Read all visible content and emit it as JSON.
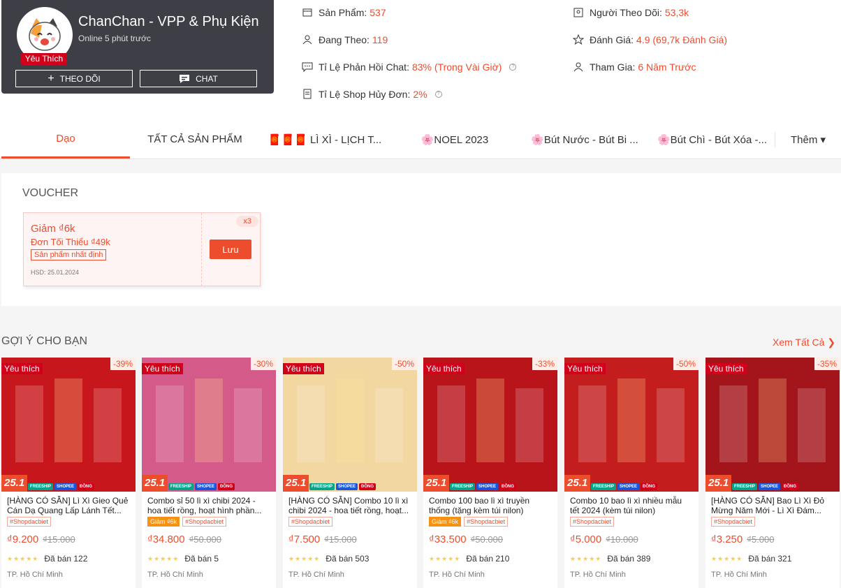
{
  "shop": {
    "name": "ChanChan - VPP & Phụ Kiện",
    "online": "Online 5 phút trước",
    "fav_badge": "Yêu Thích",
    "follow_label": "THEO DÕI",
    "chat_label": "CHAT"
  },
  "stats": {
    "products_label": "Sản Phẩm:",
    "products_value": "537",
    "following_label": "Đang Theo:",
    "following_value": "119",
    "chat_label": "Tỉ Lệ Phản Hồi Chat:",
    "chat_value": "83% (Trong Vài Giờ)",
    "cancel_label": "Tỉ Lệ Shop Hủy Đơn:",
    "cancel_value": "2%",
    "followers_label": "Người Theo Dõi:",
    "followers_value": "53,3k",
    "rating_label": "Đánh Giá:",
    "rating_value": "4.9 (69,7k Đánh Giá)",
    "joined_label": "Tham Gia:",
    "joined_value": "6 Năm Trước"
  },
  "tabs": [
    "Dạo",
    "TẤT CẢ SẢN PHẨM",
    "🧧🧧🧧 LÌ XÌ - LỊCH T...",
    "🌸NOEL 2023",
    "🌸Bút Nước - Bút Bi ...",
    "🌸Bút Chì - Bút Xóa -...",
    "Thêm ▾"
  ],
  "voucher": {
    "section_title": "VOUCHER",
    "discount": "Giảm ₫6k",
    "min_order": "Đơn Tối Thiểu ₫49k",
    "condition": "Sản phẩm nhất định",
    "expiry": "HSD: 25.01.2024",
    "count": "x3",
    "save_label": "Lưu"
  },
  "suggest": {
    "title": "GỢI Ý CHO BẠN",
    "see_all": "Xem Tất Cả ❯"
  },
  "products": [
    {
      "title": "[HÀNG CÓ SẴN] Lì Xì Gieo Quẻ Cán Dạ Quang Lấp Lánh Tết...",
      "fav": "Yêu thích",
      "discount": "-39%",
      "date": "25.1",
      "tags": [
        "#Shopdacbiet"
      ],
      "price": "₫9.200",
      "old_price": "₫15.000",
      "sold": "Đã bán 122",
      "location": "TP. Hồ Chí Minh",
      "color": "#c8171c"
    },
    {
      "title": "Combo sỉ 50 lì xì chibi 2024 - hoa tiết rồng, hoạt hình phần...",
      "fav": "Yêu thích",
      "discount": "-30%",
      "date": "25.1",
      "tags": [
        "Giảm ₫6k",
        "#Shopdacbiet"
      ],
      "price": "₫34.800",
      "old_price": "₫50.000",
      "sold": "Đã bán 5",
      "location": "TP. Hồ Chí Minh",
      "color": "#d45a8a"
    },
    {
      "title": "[HÀNG CÓ SẴN] Combo 10 lì xì chibi 2024 - hoa tiết rồng, hoạt...",
      "fav": "Yêu thích",
      "discount": "-50%",
      "date": "25.1",
      "tags": [
        "#Shopdacbiet"
      ],
      "price": "₫7.500",
      "old_price": "₫15.000",
      "sold": "Đã bán 503",
      "location": "TP. Hồ Chí Minh",
      "color": "#f2d7a0"
    },
    {
      "title": "Combo 100 bao lì xì truyền thống (tặng kèm túi nilon)",
      "fav": "Yêu thích",
      "discount": "-33%",
      "date": "25.1",
      "tags": [
        "Giảm ₫6k",
        "#Shopdacbiet"
      ],
      "price": "₫33.500",
      "old_price": "₫50.000",
      "sold": "Đã bán 210",
      "location": "TP. Hồ Chí Minh",
      "color": "#b8141a"
    },
    {
      "title": "Combo 10 bao lì xì nhiều mẫu tết 2024 (kèm túi nilon)",
      "fav": "Yêu thích",
      "discount": "-50%",
      "date": "25.1",
      "tags": [
        "#Shopdacbiet"
      ],
      "price": "₫5.000",
      "old_price": "₫10.000",
      "sold": "Đã bán 389",
      "location": "TP. Hồ Chí Minh",
      "color": "#c41d1d"
    },
    {
      "title": "[HÀNG CÓ SẴN] Bao Lì Xì Đỏ Mừng Năm Mới - Lì Xì Đám...",
      "fav": "Yêu thích",
      "discount": "-35%",
      "date": "25.1",
      "tags": [
        "#Shopdacbiet"
      ],
      "price": "₫3.250",
      "old_price": "₫5.000",
      "sold": "Đã bán 321",
      "location": "TP. Hồ Chí Minh",
      "color": "#a3151b"
    }
  ]
}
